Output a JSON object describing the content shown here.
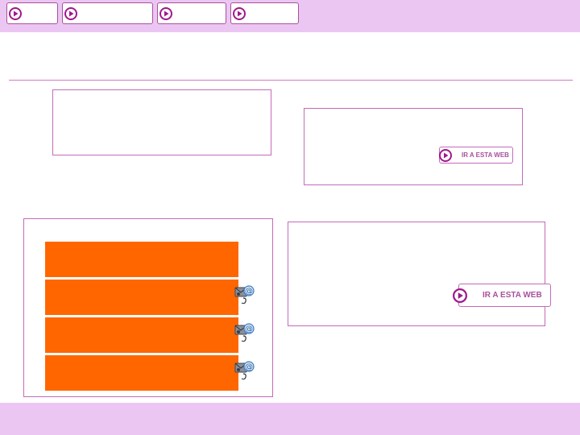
{
  "nav": {
    "items": [
      {
        "label": ""
      },
      {
        "label": ""
      },
      {
        "label": ""
      },
      {
        "label": ""
      }
    ]
  },
  "panels": {
    "upper_right": {
      "go_label": "IR A ESTA WEB"
    },
    "lower_right": {
      "go_label": "IR A ESTA WEB"
    }
  },
  "list": {
    "rows": [
      {
        "label": ""
      },
      {
        "label": ""
      },
      {
        "label": ""
      },
      {
        "label": ""
      }
    ]
  },
  "footer": {
    "text": ""
  },
  "colors": {
    "accent": "#a8519c",
    "band": "#ecc6f3",
    "orange": "#ff6600"
  },
  "icons": [
    "play-icon",
    "mail-at-icon"
  ]
}
